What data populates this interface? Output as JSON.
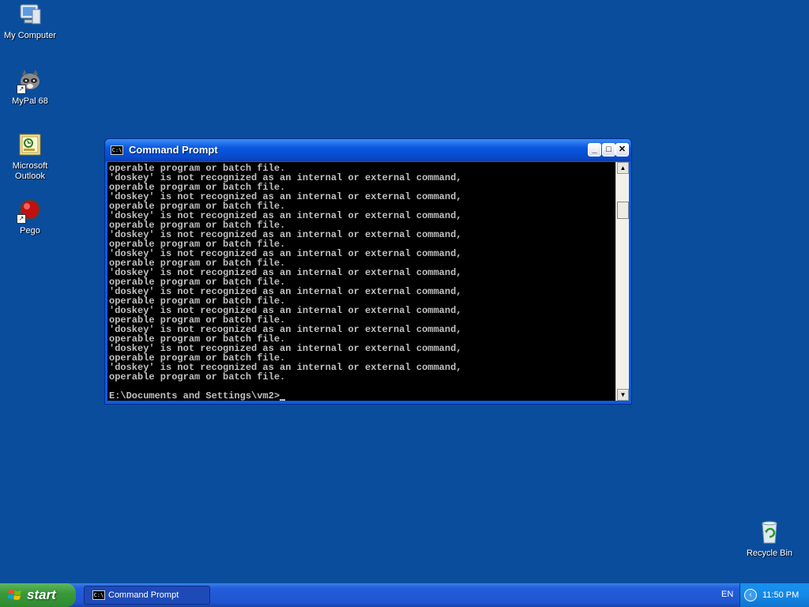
{
  "desktop": {
    "icons": [
      {
        "label": "My Computer",
        "icon": "computer-icon"
      },
      {
        "label": "MyPal 68",
        "icon": "raccoon-browser-icon"
      },
      {
        "label": "Microsoft Outlook",
        "icon": "outlook-icon"
      },
      {
        "label": "Pego",
        "icon": "red-ball-icon"
      },
      {
        "label": "Recycle Bin",
        "icon": "recycle-bin-icon"
      }
    ]
  },
  "window": {
    "title": "Command Prompt",
    "icon_text": "C:\\",
    "buttons": {
      "minimize": "_",
      "maximize": "□",
      "close": "✕"
    },
    "console_lines": [
      "operable program or batch file.",
      "'doskey' is not recognized as an internal or external command,",
      "operable program or batch file.",
      "'doskey' is not recognized as an internal or external command,",
      "operable program or batch file.",
      "'doskey' is not recognized as an internal or external command,",
      "operable program or batch file.",
      "'doskey' is not recognized as an internal or external command,",
      "operable program or batch file.",
      "'doskey' is not recognized as an internal or external command,",
      "operable program or batch file.",
      "'doskey' is not recognized as an internal or external command,",
      "operable program or batch file.",
      "'doskey' is not recognized as an internal or external command,",
      "operable program or batch file.",
      "'doskey' is not recognized as an internal or external command,",
      "operable program or batch file.",
      "'doskey' is not recognized as an internal or external command,",
      "operable program or batch file.",
      "'doskey' is not recognized as an internal or external command,",
      "operable program or batch file.",
      "'doskey' is not recognized as an internal or external command,",
      "operable program or batch file.",
      "",
      "E:\\Documents and Settings\\vm2>"
    ],
    "scroll_up": "▲",
    "scroll_down": "▼"
  },
  "taskbar": {
    "start_label": "start",
    "task_label": "Command Prompt",
    "language": "EN",
    "clock": "11:50 PM",
    "tray_chevron": "‹"
  },
  "colors": {
    "desktop": "#0a4d9c",
    "console_bg": "#000000",
    "console_text": "#c0c0c0"
  }
}
